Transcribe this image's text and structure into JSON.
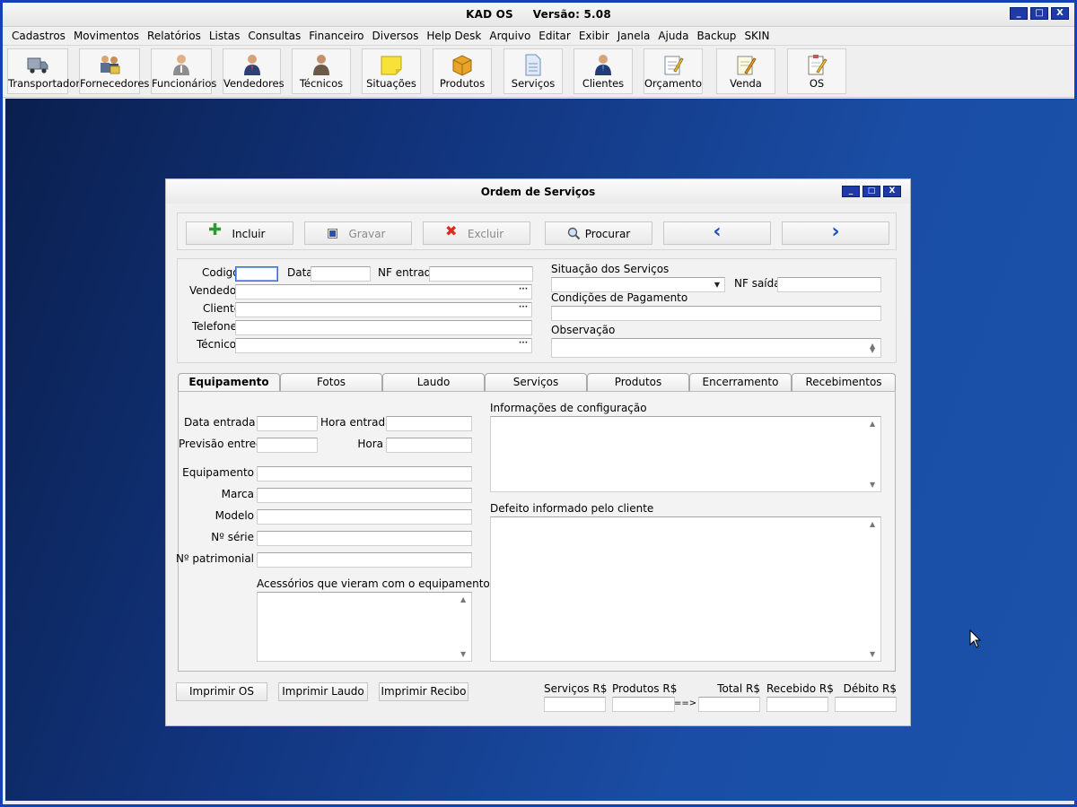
{
  "app": {
    "title": "KAD OS",
    "version": "Versão: 5.08",
    "window_buttons": [
      "_",
      "□",
      "X"
    ]
  },
  "menu": [
    "Cadastros",
    "Movimentos",
    "Relatórios",
    "Listas",
    "Consultas",
    "Financeiro",
    "Diversos",
    "Help Desk",
    "Arquivo",
    "Editar",
    "Exibir",
    "Janela",
    "Ajuda",
    "Backup",
    "SKIN"
  ],
  "toolbar": [
    {
      "label": "Transportador",
      "icon": "truck-icon"
    },
    {
      "label": "Fornecedores",
      "icon": "suppliers-icon"
    },
    {
      "label": "Funcionários",
      "icon": "employee-icon"
    },
    {
      "label": "Vendedores",
      "icon": "salesperson-icon"
    },
    {
      "label": "Técnicos",
      "icon": "technician-icon"
    },
    {
      "label": "Situações",
      "icon": "sticky-note-icon"
    },
    {
      "label": "Produtos",
      "icon": "box-icon"
    },
    {
      "label": "Serviços",
      "icon": "document-icon"
    },
    {
      "label": "Clientes",
      "icon": "client-icon"
    },
    {
      "label": "Orçamento",
      "icon": "notepad-pencil-icon"
    },
    {
      "label": "Venda",
      "icon": "pencil-note-icon"
    },
    {
      "label": "OS",
      "icon": "clipboard-pencil-icon"
    }
  ],
  "form": {
    "title": "Ordem de Serviços",
    "actions": {
      "incluir": "Incluir",
      "gravar": "Gravar",
      "excluir": "Excluir",
      "procurar": "Procurar",
      "prev": "‹",
      "next": "›"
    },
    "header_labels": {
      "codigo": "Codigo",
      "data": "Data",
      "nf_entrada": "NF entrada",
      "vendedor": "Vendedor",
      "cliente": "Cliente",
      "telefone": "Telefone",
      "tecnico": "Técnico",
      "situacao": "Situação dos Serviços",
      "nf_saida": "NF saída",
      "condicoes": "Condições de Pagamento",
      "observacao": "Observação"
    },
    "tabs": [
      "Equipamento",
      "Fotos",
      "Laudo",
      "Serviços",
      "Produtos",
      "Encerramento",
      "Recebimentos"
    ],
    "active_tab": "Equipamento",
    "equip_labels": {
      "data_entrada": "Data entrada",
      "hora_entrada": "Hora entrada",
      "previsao": "Previsão entrega",
      "hora": "Hora",
      "equipamento": "Equipamento",
      "marca": "Marca",
      "modelo": "Modelo",
      "serie": "Nº série",
      "patrimonial": "Nº patrimonial",
      "acessorios": "Acessórios que vieram com o equipamento",
      "config": "Informações de configuração",
      "defeito": "Defeito informado pelo cliente"
    },
    "print_buttons": {
      "os": "Imprimir OS",
      "laudo": "Imprimir Laudo",
      "recibo": "Imprimir Recibo"
    },
    "totals": {
      "servicos": "Serviços R$",
      "produtos": "Produtos R$",
      "arrow": "==>",
      "total": "Total R$",
      "recebido": "Recebido R$",
      "debito": "Débito R$"
    }
  },
  "colors": {
    "accent": "#1f3aa8",
    "desktop": "#12357f"
  }
}
